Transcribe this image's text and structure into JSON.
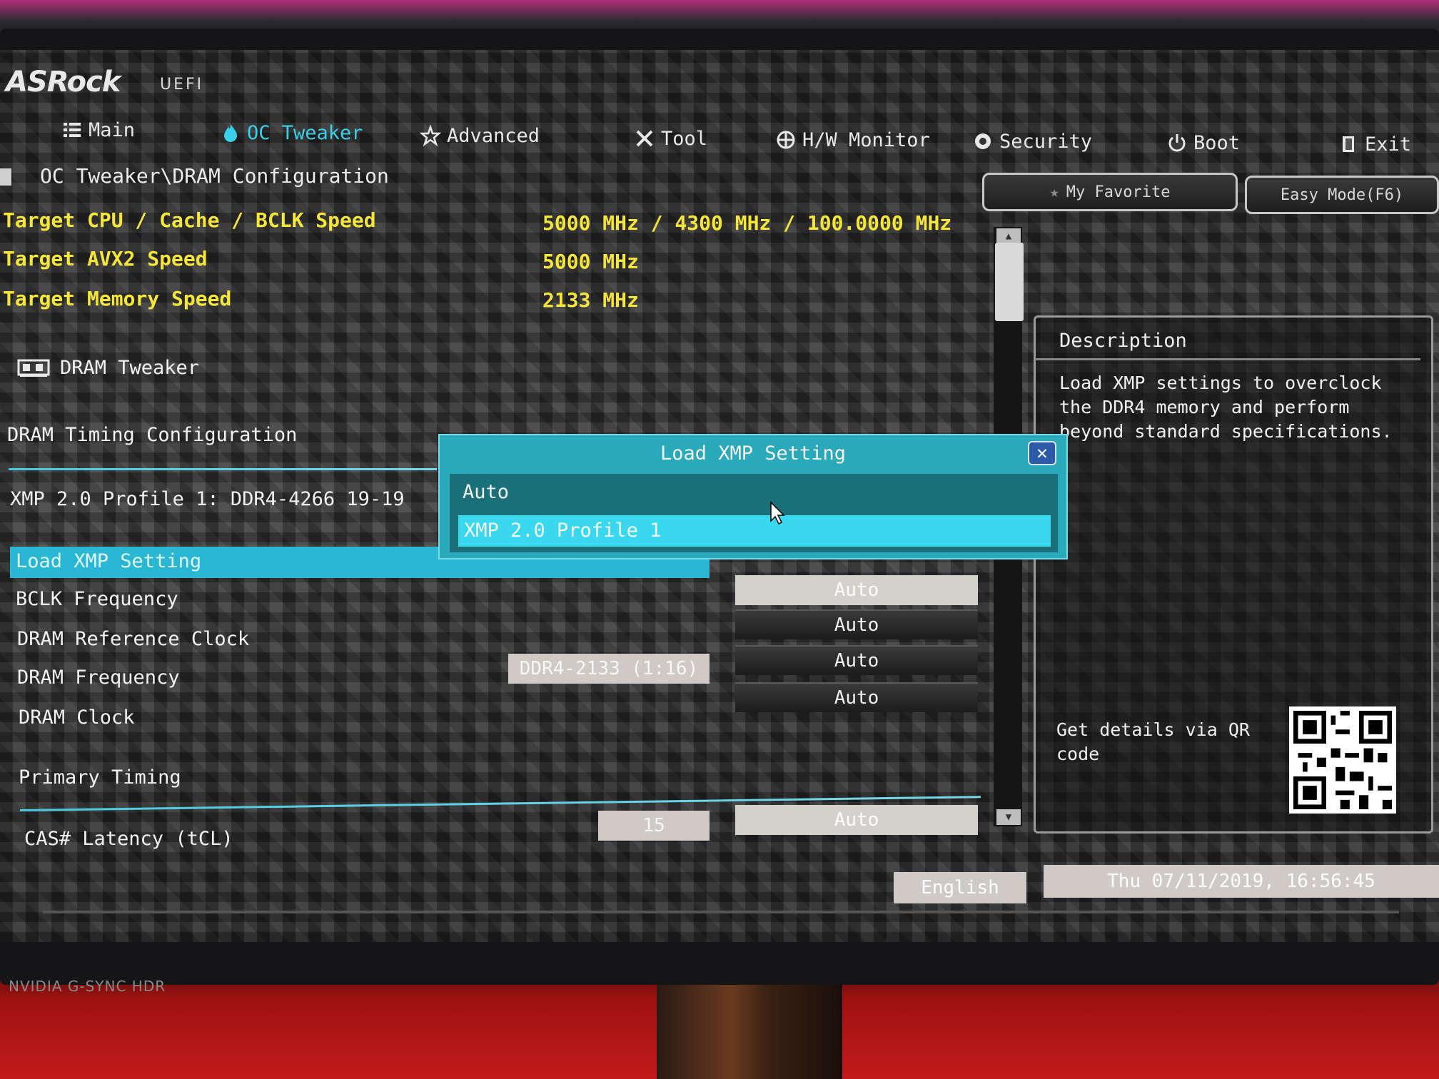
{
  "brand": {
    "logo": "ASRock",
    "logo_sub": "UEFI",
    "monitor_label": "NVIDIA G-SYNC HDR"
  },
  "tabs": [
    {
      "label": "Main",
      "icon": "list-icon"
    },
    {
      "label": "OC Tweaker",
      "icon": "flame-icon",
      "active": true
    },
    {
      "label": "Advanced",
      "icon": "star-icon"
    },
    {
      "label": "Tool",
      "icon": "tools-icon"
    },
    {
      "label": "H/W Monitor",
      "icon": "monitor-icon"
    },
    {
      "label": "Security",
      "icon": "shield-icon"
    },
    {
      "label": "Boot",
      "icon": "power-icon"
    },
    {
      "label": "Exit",
      "icon": "door-icon"
    }
  ],
  "breadcrumb": "OC Tweaker\\DRAM Configuration",
  "buttons": {
    "my_favorite": "My Favorite",
    "easy_mode": "Easy Mode(F6)"
  },
  "info": [
    {
      "label": "Target CPU / Cache / BCLK Speed",
      "value": "5000 MHz / 4300 MHz / 100.0000 MHz"
    },
    {
      "label": "Target AVX2 Speed",
      "value": "5000 MHz"
    },
    {
      "label": "Target Memory Speed",
      "value": "2133 MHz"
    }
  ],
  "menu": {
    "dram_tweaker": "DRAM Tweaker",
    "timing_config": "DRAM Timing Configuration",
    "xmp_profile": "XMP 2.0 Profile 1: DDR4-4266 19-19",
    "load_xmp": "Load XMP Setting",
    "bclk": "BCLK Frequency",
    "ref_clock": "DRAM Reference Clock",
    "dram_freq": "DRAM Frequency",
    "dram_clock": "DRAM Clock",
    "primary_timing": "Primary Timing",
    "cas_latency": "CAS# Latency (tCL)"
  },
  "values": {
    "bclk": "Auto",
    "ref_clock": "Auto",
    "dram_freq_current": "DDR4-2133 (1:16)",
    "dram_freq": "Auto",
    "dram_clock": "Auto",
    "cas_current": "15",
    "cas": "Auto"
  },
  "description": {
    "title": "Description",
    "text": "Load XMP settings to overclock the DDR4 memory and perform beyond standard specifications.",
    "qr_label": "Get details via QR code"
  },
  "modal": {
    "title": "Load XMP Setting",
    "options": [
      "Auto",
      "XMP 2.0 Profile 1"
    ],
    "selected": "XMP 2.0 Profile 1"
  },
  "footer": {
    "language": "English",
    "datetime": "Thu 07/11/2019, 16:56:45"
  }
}
